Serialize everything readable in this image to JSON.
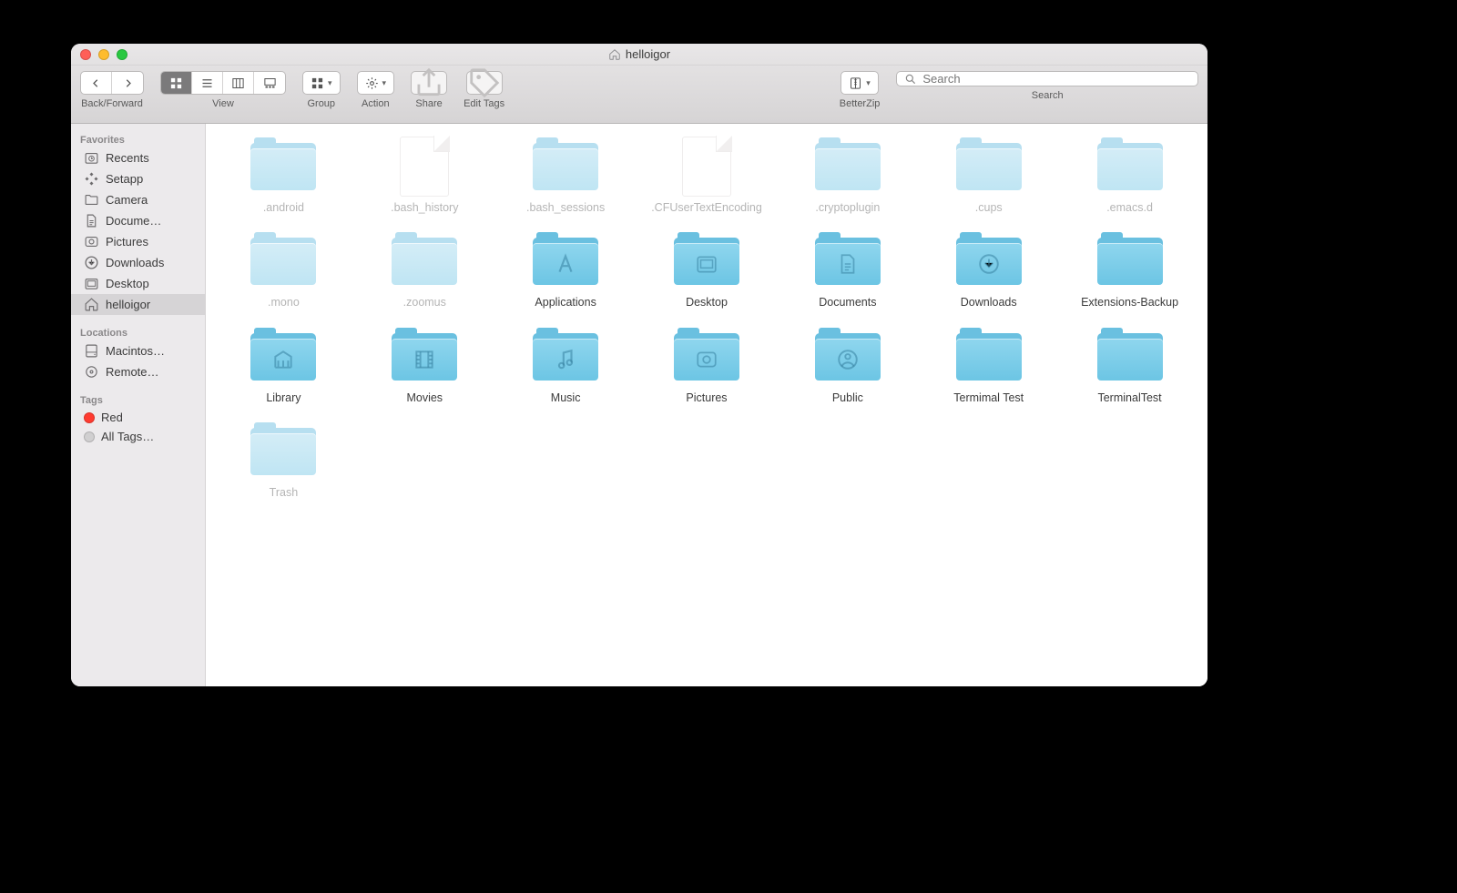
{
  "window": {
    "title": "helloigor"
  },
  "toolbar": {
    "back_forward_label": "Back/Forward",
    "view_label": "View",
    "group_label": "Group",
    "action_label": "Action",
    "share_label": "Share",
    "edit_tags_label": "Edit Tags",
    "betterzip_label": "BetterZip",
    "search_label": "Search",
    "search_placeholder": "Search"
  },
  "sidebar": {
    "favorites_title": "Favorites",
    "favorites": [
      {
        "label": "Recents",
        "icon": "clock"
      },
      {
        "label": "Setapp",
        "icon": "setapp"
      },
      {
        "label": "Camera",
        "icon": "folder"
      },
      {
        "label": "Docume…",
        "icon": "document"
      },
      {
        "label": "Pictures",
        "icon": "pictures"
      },
      {
        "label": "Downloads",
        "icon": "download"
      },
      {
        "label": "Desktop",
        "icon": "desktop"
      },
      {
        "label": "helloigor",
        "icon": "home",
        "selected": true
      }
    ],
    "locations_title": "Locations",
    "locations": [
      {
        "label": "Macintos…",
        "icon": "disk"
      },
      {
        "label": "Remote…",
        "icon": "disc"
      }
    ],
    "tags_title": "Tags",
    "tags": [
      {
        "label": "Red",
        "color": "#ff3b30"
      },
      {
        "label": "All Tags…",
        "color": "#d0cfd0"
      }
    ]
  },
  "items": [
    {
      "label": ".android",
      "type": "folder",
      "hidden": true
    },
    {
      "label": ".bash_history",
      "type": "file",
      "hidden": true
    },
    {
      "label": ".bash_sessions",
      "type": "folder",
      "hidden": true
    },
    {
      "label": ".CFUserTextEncoding",
      "type": "file",
      "hidden": true
    },
    {
      "label": ".cryptoplugin",
      "type": "folder",
      "hidden": true
    },
    {
      "label": ".cups",
      "type": "folder",
      "hidden": true
    },
    {
      "label": ".emacs.d",
      "type": "folder",
      "hidden": true
    },
    {
      "label": ".mono",
      "type": "folder",
      "hidden": true
    },
    {
      "label": ".zoomus",
      "type": "folder",
      "hidden": true
    },
    {
      "label": "Applications",
      "type": "folder",
      "emblem": "a"
    },
    {
      "label": "Desktop",
      "type": "folder",
      "emblem": "desktop"
    },
    {
      "label": "Documents",
      "type": "folder",
      "emblem": "document"
    },
    {
      "label": "Downloads",
      "type": "folder",
      "emblem": "download"
    },
    {
      "label": "Extensions-Backup",
      "type": "folder"
    },
    {
      "label": "Library",
      "type": "folder",
      "emblem": "library"
    },
    {
      "label": "Movies",
      "type": "folder",
      "emblem": "movies"
    },
    {
      "label": "Music",
      "type": "folder",
      "emblem": "music"
    },
    {
      "label": "Pictures",
      "type": "folder",
      "emblem": "pictures"
    },
    {
      "label": "Public",
      "type": "folder",
      "emblem": "public"
    },
    {
      "label": "Termimal Test",
      "type": "folder"
    },
    {
      "label": "TerminalTest",
      "type": "folder"
    },
    {
      "label": "Trash",
      "type": "folder",
      "hidden": true
    }
  ]
}
